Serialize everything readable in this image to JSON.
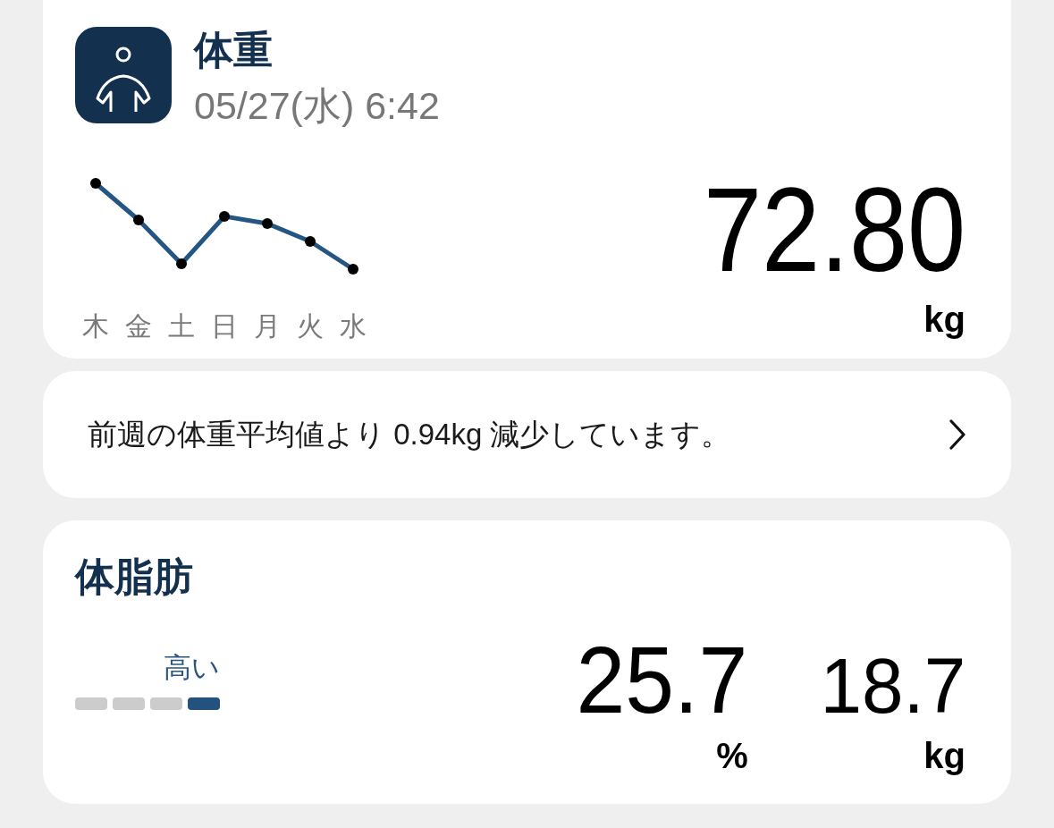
{
  "weight": {
    "title": "体重",
    "date": "05/27(水) 6:42",
    "day_labels": [
      "木",
      "金",
      "土",
      "日",
      "月",
      "火",
      "水"
    ],
    "value": "72.80",
    "unit": "kg"
  },
  "weekly_note": {
    "text": "前週の体重平均値より 0.94kg 減少しています。"
  },
  "body_fat": {
    "title": "体脂肪",
    "level_label": "高い",
    "segments": [
      {
        "selected": false
      },
      {
        "selected": false
      },
      {
        "selected": false
      },
      {
        "selected": true
      }
    ],
    "percent": {
      "value": "25.7",
      "unit": "%"
    },
    "mass": {
      "value": "18.7",
      "unit": "kg"
    }
  }
}
